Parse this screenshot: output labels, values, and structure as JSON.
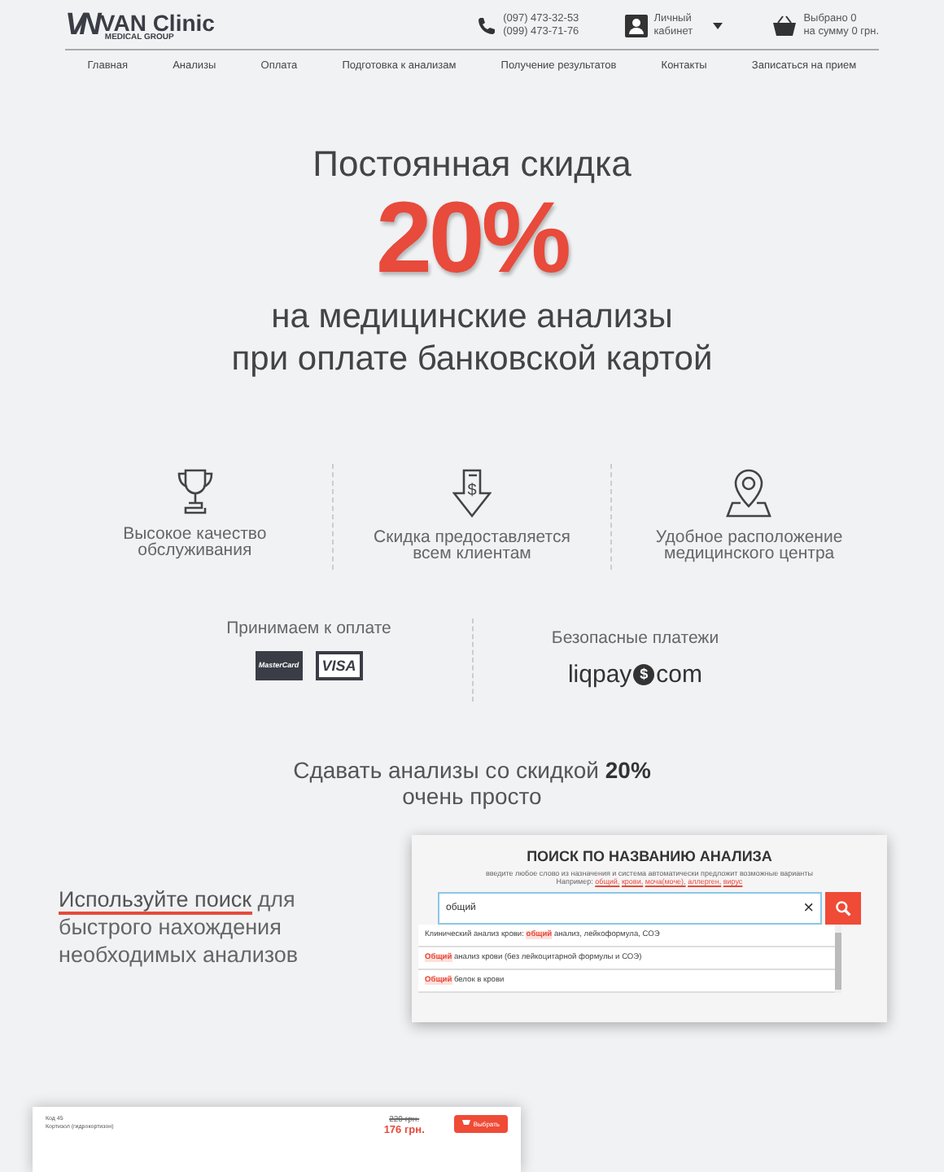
{
  "header": {
    "logo_mark": "VN",
    "logo_name": "VAN Clinic",
    "logo_sub": "MEDICAL GROUP",
    "phones": [
      "(097) 473-32-53",
      "(099) 473-71-76"
    ],
    "account": "Личный кабинет",
    "cart_lines": [
      "Выбрано 0",
      "на сумму 0 грн."
    ]
  },
  "nav": [
    "Главная",
    "Анализы",
    "Оплата",
    "Подготовка к анализам",
    "Получение результатов",
    "Контакты",
    "Записаться на прием"
  ],
  "hero": {
    "line1": "Постоянная скидка",
    "discount": "20%",
    "line2": "на медицинские анализы",
    "line3": "при оплате банковской картой"
  },
  "features": [
    {
      "kind": "trophy",
      "text": "Высокое качество обслуживания"
    },
    {
      "kind": "discount",
      "symbol": "$",
      "text": "Скидка предоставляется всем клиентам"
    },
    {
      "kind": "location",
      "text": "Удобное расположение медицинского центра"
    }
  ],
  "payment": {
    "cards_label": "Принимаем к оплате",
    "cards": [
      {
        "kind": "mastercard",
        "label": "MasterCard"
      },
      {
        "kind": "visa",
        "label": "VISA"
      }
    ],
    "secure_label": "Безопасные платежи",
    "liqpay": [
      "liqpay",
      "$",
      "com"
    ]
  },
  "steps_title": "Сдавать анализы со скидкой **20%**",
  "steps_subtitle": "очень просто",
  "tip": {
    "link": "Используйте поиск",
    "rest": " для быстрого нахождения необходимых анализов"
  },
  "search": {
    "title": "ПОИСК ПО НАЗВАНИЮ АНАЛИЗА",
    "hint": "введите любое слово из назначения и система автоматически предложит возможные варианты",
    "examples_label": "Например:",
    "examples": [
      "общий,",
      "крови,",
      "моча(моче),",
      "аллерген,",
      "вирус"
    ],
    "value": "общий",
    "clear": "×",
    "suggestions": [
      {
        "parts": [
          {
            "text": "Клинический анализ крови: ",
            "highlight": false
          },
          {
            "text": "общий",
            "highlight": true
          },
          {
            "text": " анализ, лейкоформула, СОЭ",
            "highlight": false
          }
        ]
      },
      {
        "parts": [
          {
            "text": "Общий",
            "highlight": true
          },
          {
            "text": " анализ крови (без лейкоцитарной формулы и СОЭ)",
            "highlight": false
          }
        ]
      },
      {
        "parts": [
          {
            "text": "Общий",
            "highlight": true
          },
          {
            "text": " белок в крови",
            "highlight": false
          }
        ]
      }
    ]
  },
  "result": {
    "code": "Код 45",
    "name": "Кортизол (гидрокортизон)",
    "old_price": "220 грн.",
    "price": "176 грн.",
    "button": "Выбрать"
  }
}
